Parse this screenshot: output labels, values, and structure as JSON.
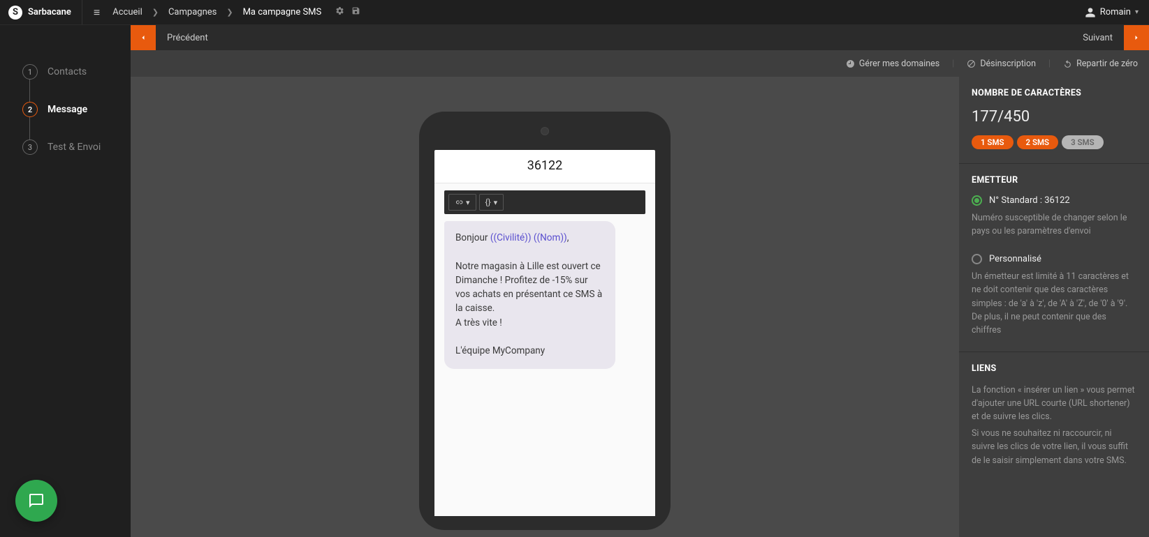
{
  "brand": "Sarbacane",
  "breadcrumb": {
    "home": "Accueil",
    "campaigns": "Campagnes",
    "current": "Ma campagne SMS"
  },
  "user": {
    "name": "Romain"
  },
  "wizard": {
    "prev": "Précédent",
    "next": "Suivant"
  },
  "steps": [
    {
      "num": "1",
      "label": "Contacts"
    },
    {
      "num": "2",
      "label": "Message"
    },
    {
      "num": "3",
      "label": "Test & Envoi"
    }
  ],
  "activeStep": 1,
  "toolbar": {
    "domains": "Gérer mes domaines",
    "unsubscribe": "Désinscription",
    "reset": "Repartir de zéro"
  },
  "phone": {
    "sender": "36122",
    "message": {
      "greeting_prefix": "Bonjour ",
      "var1": "((Civilité))",
      "var2": "((Nom))",
      "greeting_suffix": ",",
      "body": "Notre magasin à Lille est ouvert ce Dimanche ! Profitez de -15% sur vos achats en présentant ce SMS à la caisse.",
      "closing": "A très vite !",
      "signature": "L'équipe MyCompany"
    }
  },
  "panel": {
    "chars_heading": "NOMBRE DE CARACTÈRES",
    "chars_value": "177/450",
    "sms_pills": [
      "1 SMS",
      "2 SMS",
      "3 SMS"
    ],
    "emitter_heading": "EMETTEUR",
    "emitter_standard_label": "N° Standard : 36122",
    "emitter_standard_help": "Numéro susceptible de changer selon le pays ou les paramètres d'envoi",
    "emitter_custom_label": "Personnalisé",
    "emitter_custom_help": "Un émetteur est limité à 11 caractères et ne doit contenir que des caractères simples : de 'a' à 'z', de 'A' à 'Z', de '0' à '9'. De plus, il ne peut contenir que des chiffres",
    "links_heading": "LIENS",
    "links_help1": "La fonction « insérer un lien » vous permet d'ajouter une URL courte (URL shortener) et de suivre les clics.",
    "links_help2": "Si vous ne souhaitez ni raccourcir, ni suivre les clics de votre lien, il vous suffit de le saisir simplement dans votre SMS."
  }
}
